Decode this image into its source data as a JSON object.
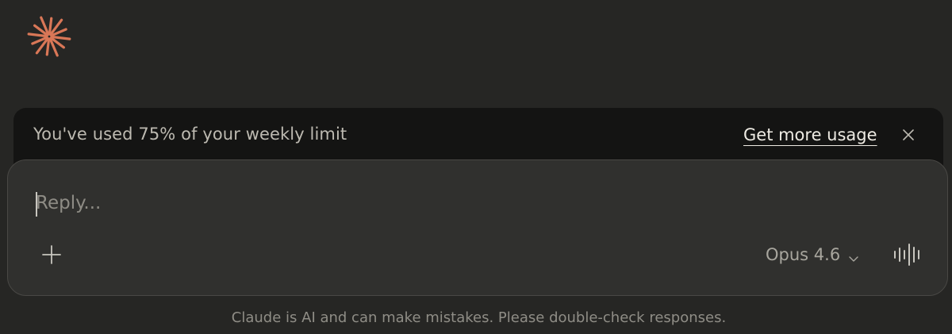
{
  "logo": {
    "icon": "claude-spark-icon",
    "color": "#d97757"
  },
  "usage_banner": {
    "message": "You've used 75% of your weekly limit",
    "usage_percent": 75,
    "link_label": "Get more usage",
    "close_icon": "close-icon"
  },
  "composer": {
    "placeholder": "Reply...",
    "add_icon": "plus-icon",
    "model": "Opus 4.6",
    "model_chevron_icon": "chevron-down-icon",
    "voice_icon": "voice-waveform-icon"
  },
  "footer": {
    "disclaimer": "Claude is AI and can make mistakes. Please double-check responses."
  }
}
